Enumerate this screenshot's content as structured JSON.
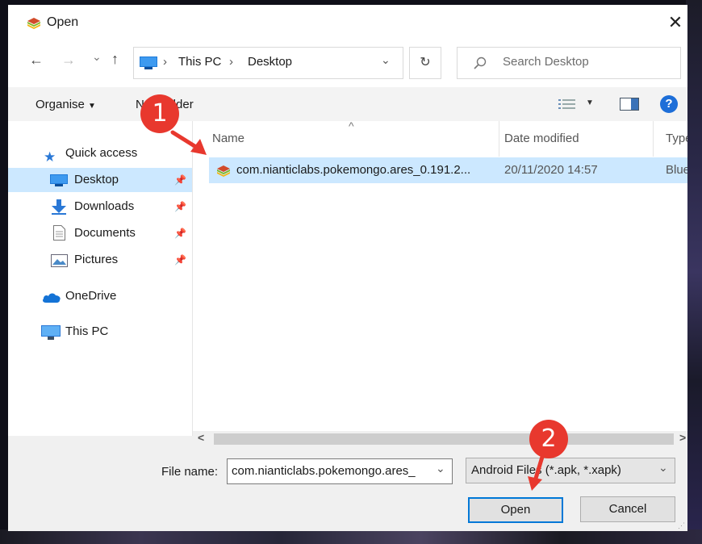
{
  "dialog": {
    "title": "Open",
    "close_glyph": "✕"
  },
  "nav": {
    "back": "←",
    "forward": "→",
    "recent": "⌄",
    "up": "↑",
    "breadcrumb": [
      "This PC",
      "Desktop"
    ],
    "breadcrumb_sep": "›",
    "dropdown": "⌄",
    "refresh": "↻",
    "search_placeholder": "Search Desktop"
  },
  "toolbar": {
    "organise": "Organise",
    "new_folder": "New folder",
    "help": "?"
  },
  "sidebar": {
    "items": [
      {
        "label": "Quick access",
        "icon": "star-icon"
      },
      {
        "label": "Desktop",
        "icon": "desktop-folder-icon",
        "pinned": true,
        "selected": true
      },
      {
        "label": "Downloads",
        "icon": "download-arrow-icon",
        "pinned": true
      },
      {
        "label": "Documents",
        "icon": "document-icon",
        "pinned": true
      },
      {
        "label": "Pictures",
        "icon": "pictures-icon",
        "pinned": true
      },
      {
        "label": "OneDrive",
        "icon": "cloud-icon"
      },
      {
        "label": "This PC",
        "icon": "computer-icon"
      }
    ]
  },
  "files": {
    "columns": [
      "Name",
      "Date modified",
      "Type"
    ],
    "sort_glyph": "^",
    "rows": [
      {
        "name": "com.nianticlabs.pokemongo.ares_0.191.2...",
        "date": "20/11/2020 14:57",
        "type": "BlueS"
      }
    ]
  },
  "scroll": {
    "left": "<",
    "right": ">"
  },
  "bottom": {
    "filename_label": "File name:",
    "filename_value": "com.nianticlabs.pokemongo.ares_",
    "filetype_value": "Android Files (*.apk, *.xapk)",
    "open": "Open",
    "cancel": "Cancel"
  },
  "annotations": {
    "step1": "1",
    "step2": "2",
    "color": "#e8382e"
  }
}
